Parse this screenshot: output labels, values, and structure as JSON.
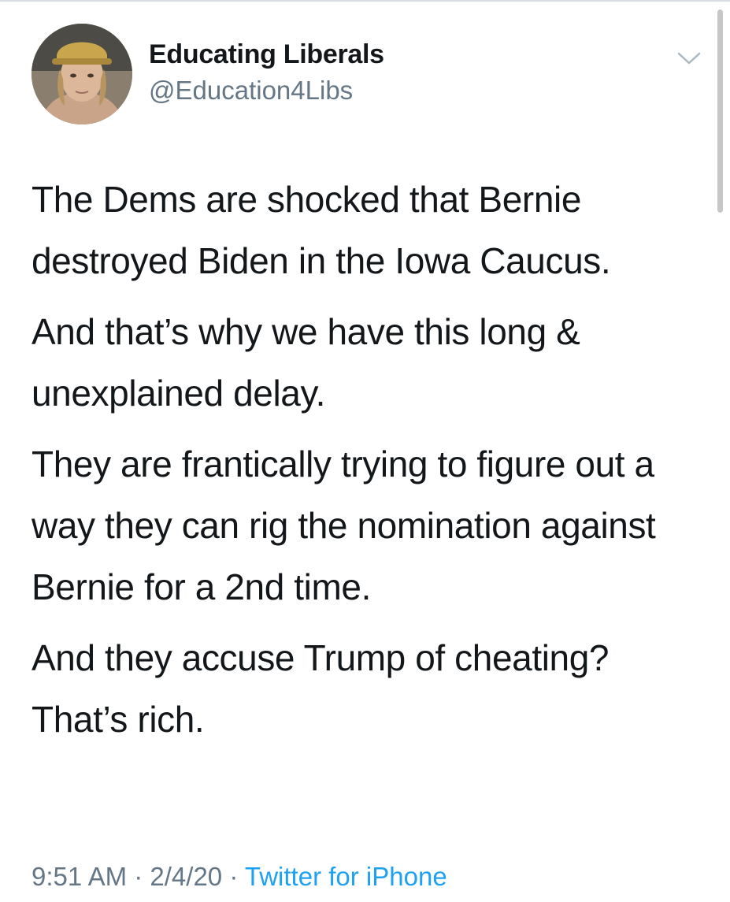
{
  "tweet": {
    "author": {
      "display_name": "Educating Liberals",
      "handle": "@Education4Libs"
    },
    "paragraphs": [
      "The Dems are shocked that Bernie destroyed Biden in the Iowa Caucus.",
      "And that’s why we have this long & unexplained delay.",
      "They are frantically trying to figure out a way they can rig the nomination against Bernie for a 2nd time.",
      "And they accuse Trump of cheating? That’s rich."
    ],
    "meta": {
      "time": "9:51 AM",
      "separator": " · ",
      "date": "2/4/20",
      "source": "Twitter for iPhone"
    }
  },
  "icons": {
    "menu": "chevron-down-icon",
    "avatar": "profile-photo"
  },
  "colors": {
    "text_primary": "#14171a",
    "text_secondary": "#657786",
    "link": "#1da1f2"
  }
}
